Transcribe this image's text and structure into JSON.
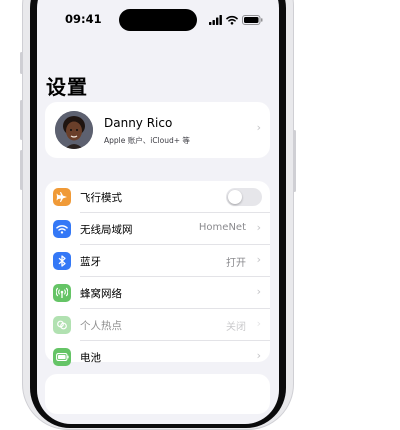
{
  "status_bar": {
    "time": "09:41"
  },
  "page": {
    "title": "设置"
  },
  "profile": {
    "name": "Danny Rico",
    "subtitle": "Apple 账户、iCloud+ 等"
  },
  "settings": [
    {
      "icon": "airplane-icon",
      "label": "飞行模式",
      "value": "",
      "toggle": true,
      "toggle_on": false,
      "color": "#f09a37",
      "dim": false
    },
    {
      "icon": "wifi-icon",
      "label": "无线局域网",
      "value": "HomeNet",
      "toggle": false,
      "color": "#3478f6",
      "dim": false
    },
    {
      "icon": "bluetooth-icon",
      "label": "蓝牙",
      "value": "打开",
      "toggle": false,
      "color": "#3478f6",
      "dim": false
    },
    {
      "icon": "cellular-icon",
      "label": "蜂窝网络",
      "value": "",
      "toggle": false,
      "color": "#65c466",
      "dim": false
    },
    {
      "icon": "hotspot-icon",
      "label": "个人热点",
      "value": "关闭",
      "toggle": false,
      "color": "#65c466",
      "dim": true
    },
    {
      "icon": "battery-icon",
      "label": "电池",
      "value": "",
      "toggle": false,
      "color": "#65c466",
      "dim": false
    }
  ]
}
